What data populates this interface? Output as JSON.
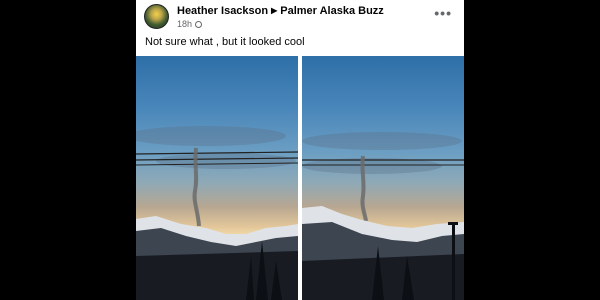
{
  "post": {
    "author": "Heather Isackson",
    "group": "Palmer Alaska Buzz",
    "time": "18h",
    "caption": "Not sure what , but it looked cool",
    "more_icon": "more-options-icon",
    "privacy_icon": "globe-icon"
  },
  "colors": {
    "page_background": "#000000",
    "card_background": "#ffffff",
    "name_text": "#050505",
    "meta_text": "#65676b"
  }
}
